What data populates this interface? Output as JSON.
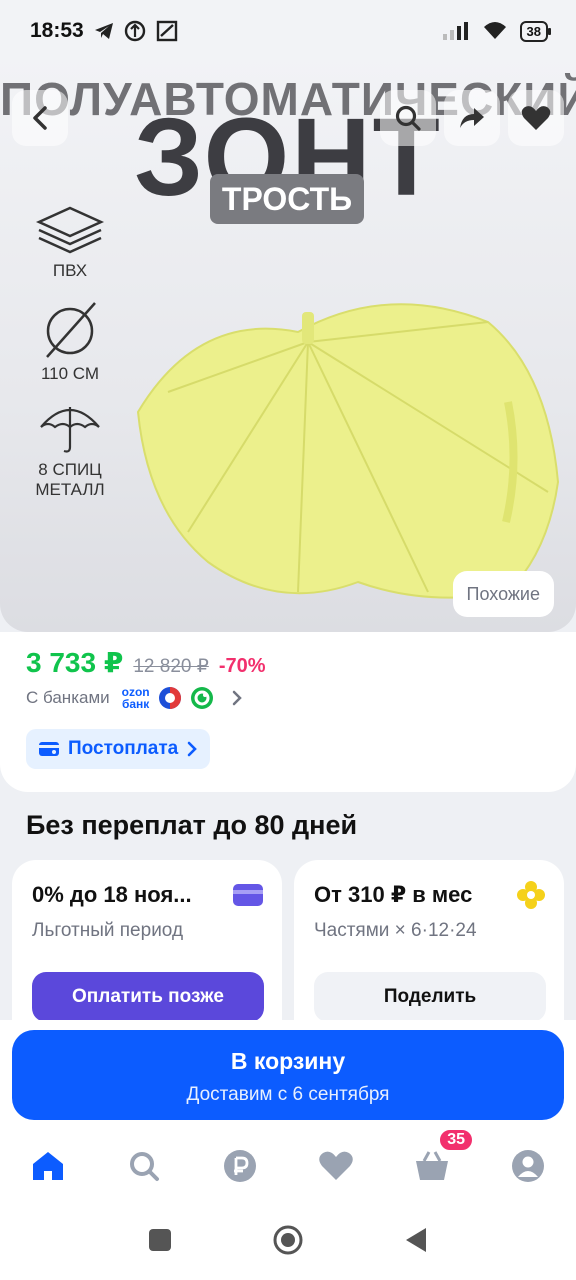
{
  "status_bar": {
    "time": "18:53",
    "battery": "38"
  },
  "hero": {
    "title_line1": "ПОЛУАВТОМАТИЧЕСКИЙ",
    "title_line2": "ЗОНТ",
    "tag": "ТРОСТЬ",
    "features": [
      {
        "icon": "layers-icon",
        "label": "ПВХ"
      },
      {
        "icon": "diameter-icon",
        "label": "110 СМ"
      },
      {
        "icon": "umbrella-icon",
        "label": "8 СПИЦ МЕТАЛЛ"
      }
    ],
    "similar_label": "Похожие"
  },
  "price": {
    "current": "3 733 ₽",
    "old": "12 820 ₽",
    "discount": "-70%",
    "banks_label": "С банками",
    "ozon_bank_line1": "ozon",
    "ozon_bank_line2": "банк",
    "postpay_label": "Постоплата"
  },
  "installments": {
    "title": "Без переплат до 80 дней",
    "card1": {
      "title": "0% до 18 ноя...",
      "subtitle": "Льготный период",
      "button": "Оплатить позже"
    },
    "card2": {
      "title": "От 310 ₽ в мес",
      "subtitle": "Частями × 6·12·24",
      "button": "Поделить"
    }
  },
  "cart": {
    "label": "В корзину",
    "delivery": "Доставим с 6 сентября"
  },
  "tabbar": {
    "cart_badge": "35"
  },
  "colors": {
    "accent": "#0c5cff",
    "price_green": "#10c44c",
    "discount_pink": "#f2306d",
    "umbrella": "#ecf08c"
  }
}
